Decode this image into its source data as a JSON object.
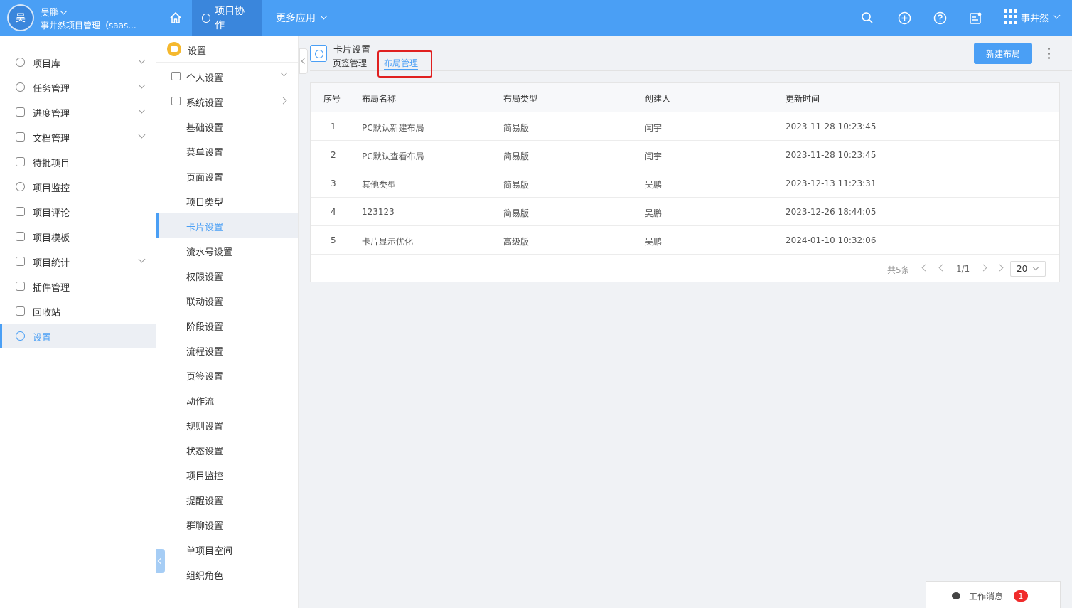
{
  "header": {
    "avatar_text": "吴",
    "user_name": "吴鹏",
    "org_name": "事井然项目管理（saas...",
    "nav_tabs": [
      {
        "label": "项目协作"
      },
      {
        "label": "更多应用"
      }
    ],
    "brand_text": "事井然",
    "icons": [
      "home-icon",
      "search-icon",
      "plus-circle-icon",
      "help-icon",
      "message-board-icon"
    ],
    "accent_color": "#4a9ff5"
  },
  "left_nav": {
    "items": [
      {
        "label": "项目库",
        "icon": "project-library-icon"
      },
      {
        "label": "任务管理",
        "icon": "at-icon"
      },
      {
        "label": "进度管理",
        "icon": "progress-icon"
      },
      {
        "label": "文档管理",
        "icon": "document-icon"
      },
      {
        "label": "待批项目",
        "icon": "pending-icon"
      },
      {
        "label": "项目监控",
        "icon": "monitor-icon"
      },
      {
        "label": "项目评论",
        "icon": "comment-icon"
      },
      {
        "label": "项目模板",
        "icon": "template-icon"
      },
      {
        "label": "项目统计",
        "icon": "stats-icon"
      },
      {
        "label": "插件管理",
        "icon": "plugin-icon"
      },
      {
        "label": "回收站",
        "icon": "trash-icon"
      },
      {
        "label": "设置",
        "icon": "settings-icon"
      }
    ]
  },
  "sub_nav": {
    "title": "设置",
    "groups": [
      {
        "label": "个人设置"
      },
      {
        "label": "系统设置"
      }
    ],
    "items": [
      {
        "label": "基础设置"
      },
      {
        "label": "菜单设置"
      },
      {
        "label": "页面设置"
      },
      {
        "label": "项目类型"
      },
      {
        "label": "卡片设置"
      },
      {
        "label": "流水号设置"
      },
      {
        "label": "权限设置"
      },
      {
        "label": "联动设置"
      },
      {
        "label": "阶段设置"
      },
      {
        "label": "流程设置"
      },
      {
        "label": "页签设置"
      },
      {
        "label": "动作流"
      },
      {
        "label": "规则设置"
      },
      {
        "label": "状态设置"
      },
      {
        "label": "项目监控"
      },
      {
        "label": "提醒设置"
      },
      {
        "label": "群聊设置"
      },
      {
        "label": "单项目空间"
      },
      {
        "label": "组织角色"
      }
    ]
  },
  "content": {
    "page_title": "卡片设置",
    "tabs": [
      {
        "label": "页签管理"
      },
      {
        "label": "布局管理"
      }
    ],
    "new_button_label": "新建布局",
    "table": {
      "columns": [
        "序号",
        "布局名称",
        "布局类型",
        "创建人",
        "更新时间"
      ],
      "rows": [
        [
          "1",
          "PC默认新建布局",
          "简易版",
          "闫宇",
          "2023-11-28 10:23:45"
        ],
        [
          "2",
          "PC默认查看布局",
          "简易版",
          "闫宇",
          "2023-11-28 10:23:45"
        ],
        [
          "3",
          "其他类型",
          "简易版",
          "吴鹏",
          "2023-12-13 11:23:31"
        ],
        [
          "4",
          "123123",
          "简易版",
          "吴鹏",
          "2023-12-26 18:44:05"
        ],
        [
          "5",
          "卡片显示优化",
          "高级版",
          "吴鹏",
          "2024-01-10 10:32:06"
        ]
      ]
    },
    "pagination": {
      "total_text": "共5条",
      "page_text": "1/1",
      "page_size": "20"
    }
  },
  "work_message": {
    "label": "工作消息",
    "count": "1"
  }
}
